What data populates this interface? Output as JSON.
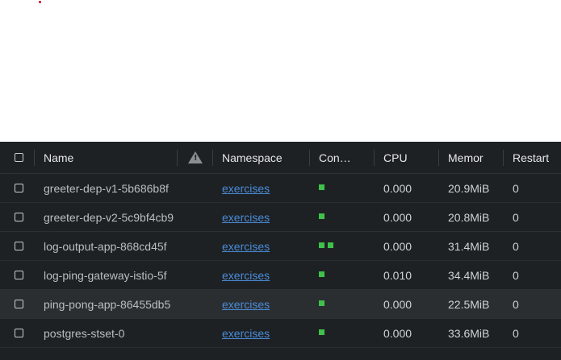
{
  "table": {
    "headers": {
      "name": "Name",
      "namespace": "Namespace",
      "containers": "Con…",
      "cpu": "CPU",
      "memory": "Memor",
      "restarts": "Restart"
    },
    "warning_icon": "warning-triangle-icon",
    "container_status_color": "#3ec24a",
    "rows": [
      {
        "name": "greeter-dep-v1-5b686b8f",
        "namespace": "exercises",
        "containers": 1,
        "cpu": "0.000",
        "memory": "20.9MiB",
        "restarts": "0"
      },
      {
        "name": "greeter-dep-v2-5c9bf4cb9",
        "namespace": "exercises",
        "containers": 1,
        "cpu": "0.000",
        "memory": "20.8MiB",
        "restarts": "0"
      },
      {
        "name": "log-output-app-868cd45f",
        "namespace": "exercises",
        "containers": 2,
        "cpu": "0.000",
        "memory": "31.4MiB",
        "restarts": "0"
      },
      {
        "name": "log-ping-gateway-istio-5f",
        "namespace": "exercises",
        "containers": 1,
        "cpu": "0.010",
        "memory": "34.4MiB",
        "restarts": "0"
      },
      {
        "name": "ping-pong-app-86455db5",
        "namespace": "exercises",
        "containers": 1,
        "cpu": "0.000",
        "memory": "22.5MiB",
        "restarts": "0"
      },
      {
        "name": "postgres-stset-0",
        "namespace": "exercises",
        "containers": 1,
        "cpu": "0.000",
        "memory": "33.6MiB",
        "restarts": "0"
      }
    ]
  }
}
